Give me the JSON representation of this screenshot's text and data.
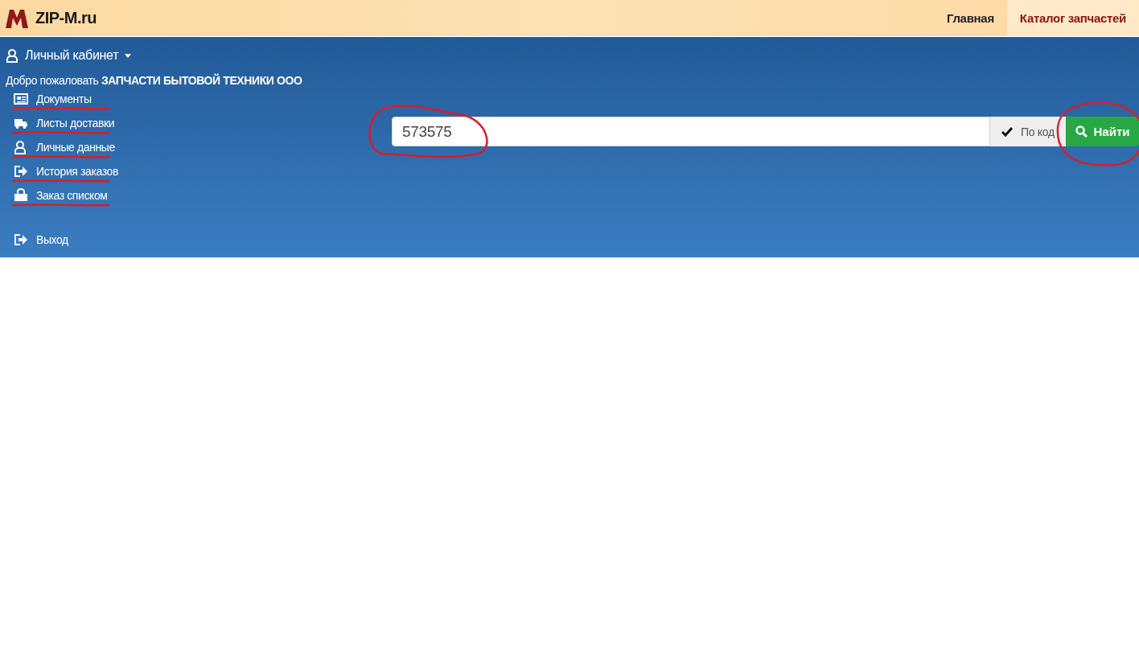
{
  "header": {
    "logo_text": "ZIP-M.ru",
    "nav": [
      {
        "label": "Главная",
        "selected": false
      },
      {
        "label": "Каталог запчастей",
        "selected": true
      }
    ]
  },
  "account": {
    "label": "Личный кабинет",
    "welcome": "Добро пожаловать **ЗАПЧАСТИ БЫТОВОЙ ТЕХНИКИ ООО**"
  },
  "menu": [
    {
      "kind": "documents",
      "label": "Документы",
      "underlined": true
    },
    {
      "kind": "truck",
      "label": "Листы доставки",
      "underlined": true
    },
    {
      "kind": "user",
      "label": "Личные данные",
      "underlined": true
    },
    {
      "kind": "exit",
      "label": "История заказов",
      "underlined": true
    },
    {
      "kind": "bag",
      "label": "Заказ списком",
      "underlined": true
    },
    {
      "kind": "exit",
      "label": "Выход",
      "underlined": false
    }
  ],
  "search": {
    "value": "573575",
    "circled": true,
    "toggle": {
      "label": "По код",
      "checked": true
    },
    "button": {
      "label": "Найти",
      "circled": true
    }
  }
}
